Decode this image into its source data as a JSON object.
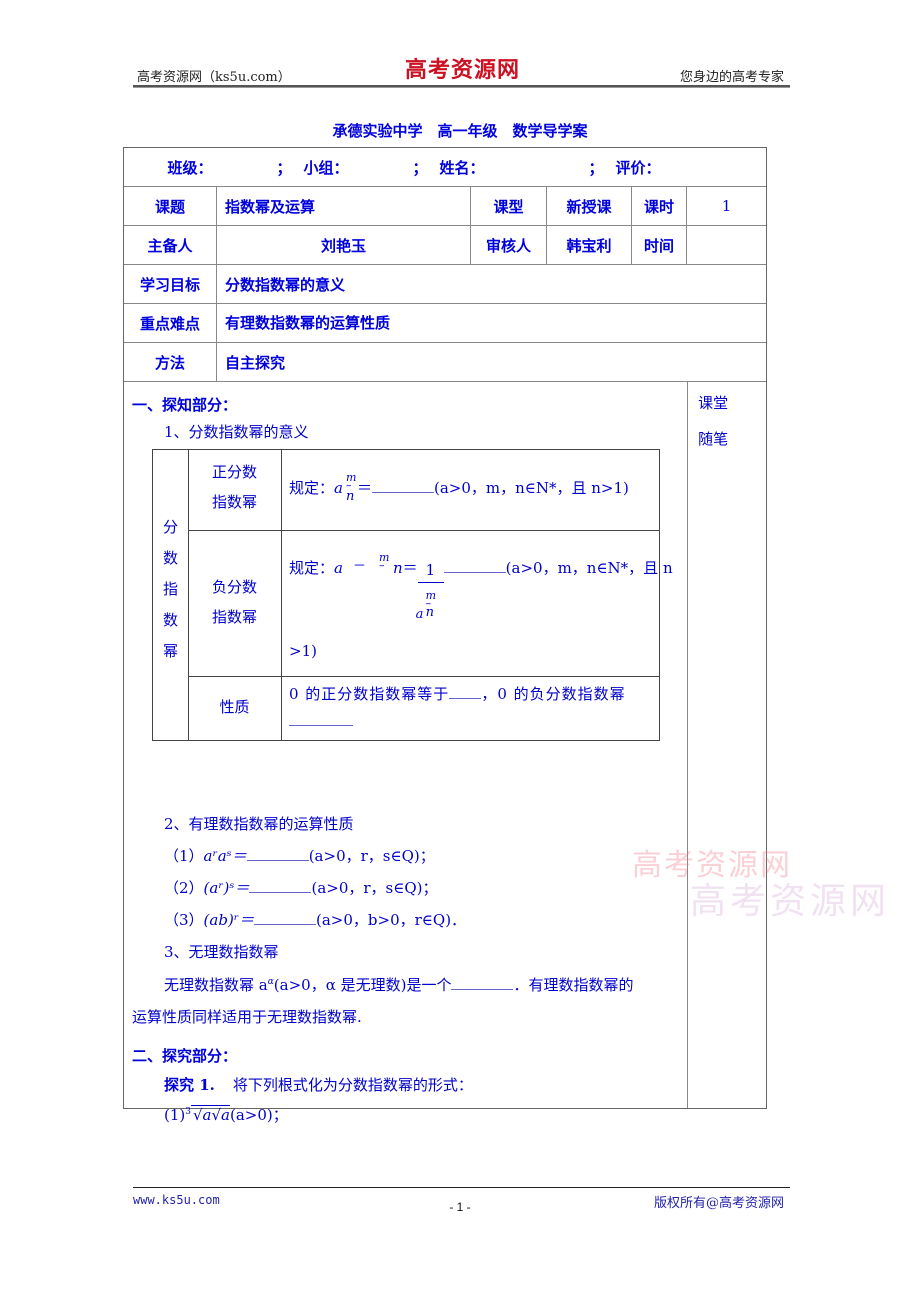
{
  "header": {
    "left": "高考资源网（ks5u.com）",
    "brand": "高考资源网",
    "right": "您身边的高考专家"
  },
  "doc_title": "承德实验中学　高一年级　数学导学案",
  "info_row": {
    "class_label": "班级：",
    "group_label": "小组：",
    "name_label": "姓名：",
    "eval_label": "评价：",
    "sep": "；"
  },
  "meta": {
    "topic_label": "课题",
    "topic_value": "指数幂及运算",
    "type_label": "课型",
    "type_value": "新授课",
    "hours_label": "课时",
    "hours_value": "1",
    "author_label": "主备人",
    "author_value": "刘艳玉",
    "reviewer_label": "审核人",
    "reviewer_value": "韩宝利",
    "time_label": "时间",
    "time_value": "",
    "goal_label": "学习目标",
    "goal_value": "分数指数幂的意义",
    "key_label": "重点难点",
    "key_value": "有理数指数幂的运算性质",
    "method_label": "方法",
    "method_value": "自主探究"
  },
  "notes_column": [
    "课堂",
    "随笔"
  ],
  "section1": {
    "heading": "一、探知部分：",
    "sub1": "1、分数指数幂的意义",
    "inner_table": {
      "group_label": [
        "分",
        "数",
        "指",
        "数",
        "幂"
      ],
      "rows": [
        {
          "label": [
            "正分数",
            "指数幂"
          ],
          "prefix": "规定：",
          "base": "a",
          "num": "m",
          "den": "n",
          "eq": "＝",
          "cond": "(a>0，m，n∈N*，且 n>1)"
        },
        {
          "label": [
            "负分数",
            "指数幂"
          ],
          "prefix": "规定：",
          "base": "a",
          "minus": "－",
          "num": "m",
          "den": "n",
          "eq": "＝",
          "one": "1",
          "cond": "(a>0，m，n∈N*，且 n",
          "cond_tail": ">1)"
        },
        {
          "label": [
            "性质"
          ],
          "text_a": "0 的正分数指数幂等于",
          "text_b": "，0 的负分数指数幂"
        }
      ]
    },
    "sub2": "2、有理数指数幂的运算性质",
    "rules": [
      {
        "num": "（1）",
        "expr": "aʳaˢ＝",
        "cond": "(a>0，r，s∈Q)；"
      },
      {
        "num": "（2）",
        "expr": "(aʳ)ˢ＝",
        "cond": "(a>0，r，s∈Q)；"
      },
      {
        "num": "（3）",
        "expr": "(ab)ʳ＝",
        "cond": "(a>0，b>0，r∈Q)．"
      }
    ],
    "sub3": "3、无理数指数幂",
    "irr_a": "无理数指数幂 a",
    "irr_sup": "α",
    "irr_b": "(a>0，α 是无理数)是一个",
    "irr_c": "．有理数指数幂的",
    "irr_d": "运算性质同样适用于无理数指数幂."
  },
  "section2": {
    "heading": "二、探究部分：",
    "explore_label": "探究 1.",
    "explore_text": "将下列根式化为分数指数幂的形式：",
    "item1_num": "(1)",
    "item1_index": "3",
    "item1_radicand": "a√a",
    "item1_cond": "(a>0)；"
  },
  "watermark": {
    "line1": "高考资源网",
    "line2": "高考资源网"
  },
  "footer": {
    "left": "www.ks5u.com",
    "page": "- 1 -",
    "right": "版权所有@高考资源网"
  }
}
